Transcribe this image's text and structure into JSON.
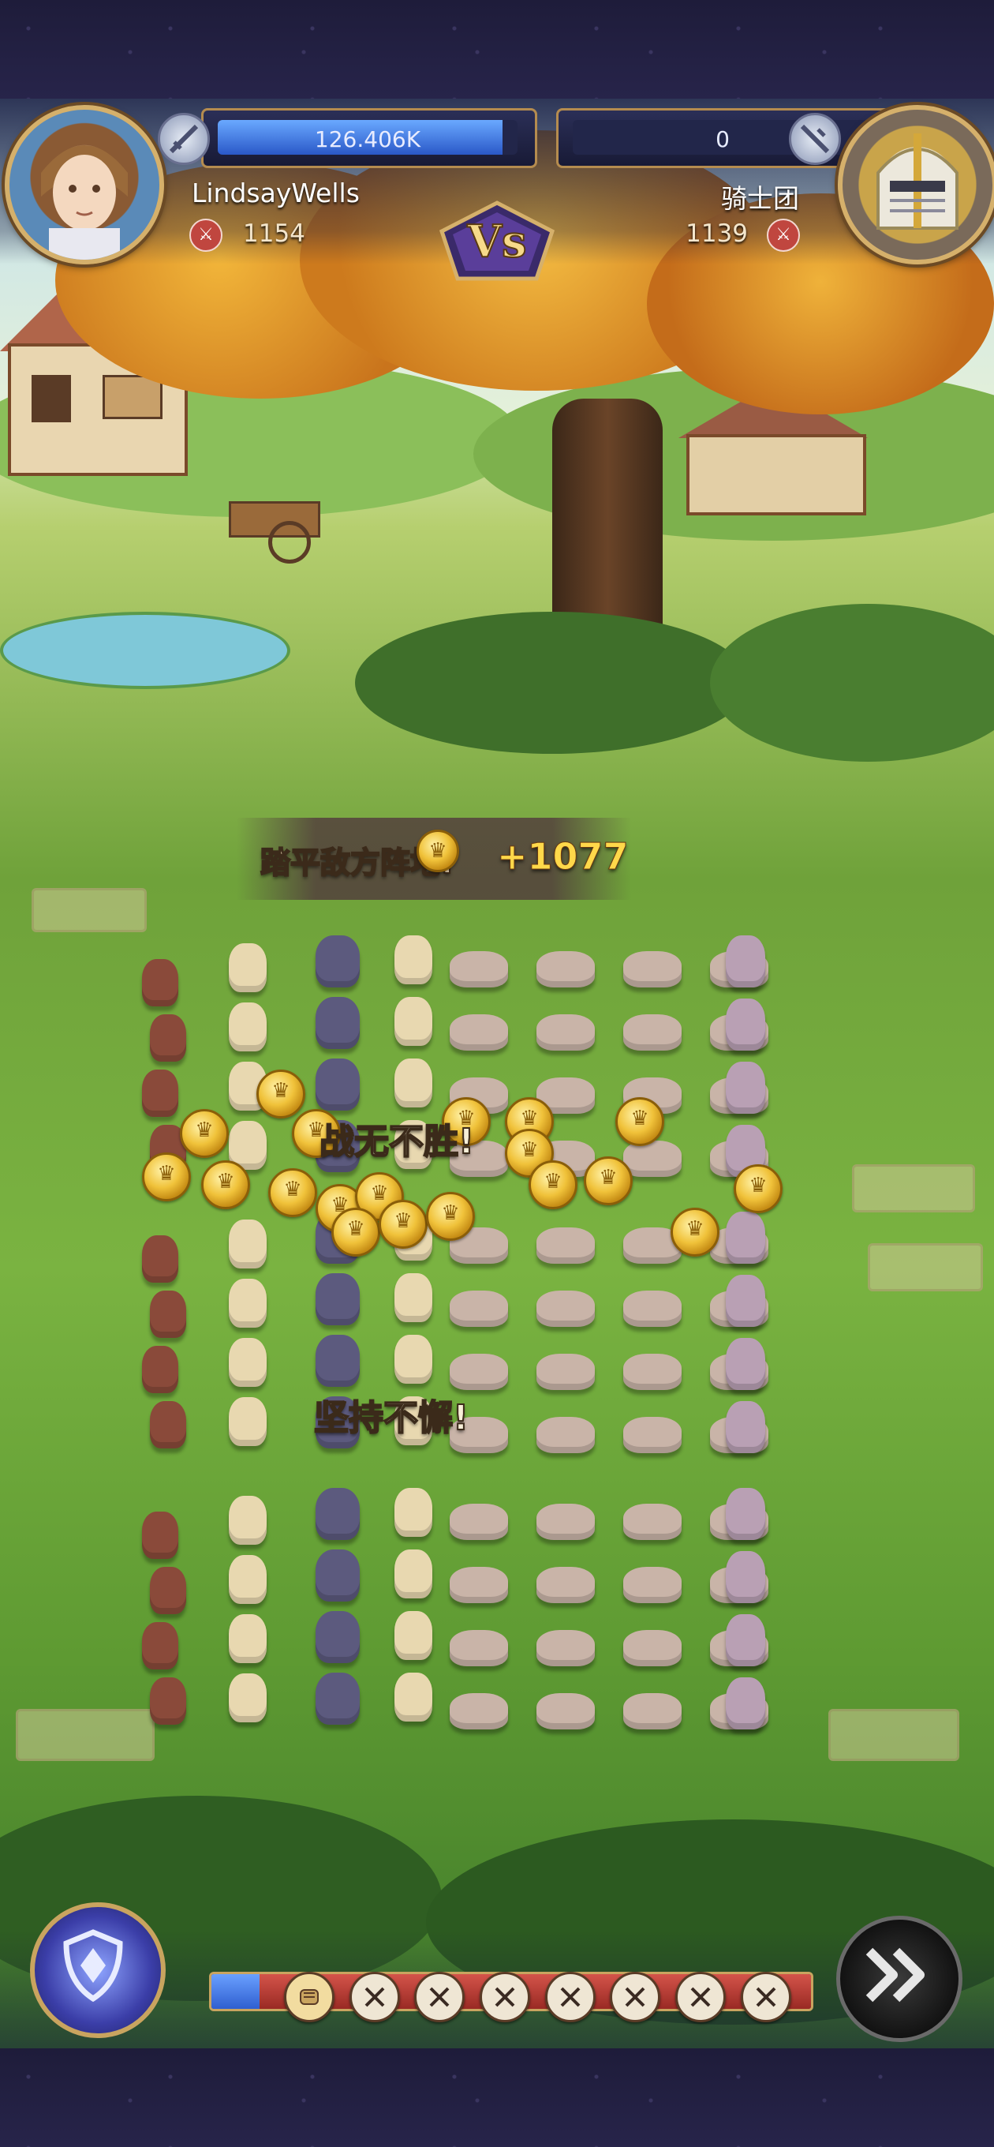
{
  "player": {
    "name": "LindsayWells",
    "hp_text": "126.406K",
    "hp_fraction": 0.95,
    "power": "1154",
    "avatar_icon": "hero-portrait"
  },
  "enemy": {
    "name": "骑士团",
    "hp_text": "0",
    "hp_fraction": 0,
    "power": "1139",
    "avatar_icon": "knight-portrait"
  },
  "vs_label": "Vs",
  "reward": {
    "label": "踏平敌方阵地!",
    "amount": "+1077",
    "icon": "gold-coin-icon"
  },
  "shouts": {
    "shout_1": "战无不胜!",
    "shout_2": "坚持不懈!"
  },
  "bottom": {
    "skill_icon": "shield-skill-icon",
    "speed_icon": "fast-forward-icon",
    "progress_fraction": 0.08,
    "waves": [
      {
        "icon": "fist-icon",
        "state": "current"
      },
      {
        "icon": "crossed-swords-icon",
        "state": "pending"
      },
      {
        "icon": "crossed-swords-icon",
        "state": "pending"
      },
      {
        "icon": "crossed-swords-icon",
        "state": "pending"
      },
      {
        "icon": "crossed-swords-icon",
        "state": "pending"
      },
      {
        "icon": "crossed-swords-icon",
        "state": "pending"
      },
      {
        "icon": "crossed-swords-icon",
        "state": "pending"
      },
      {
        "icon": "crossed-swords-icon",
        "state": "pending"
      }
    ]
  },
  "colors": {
    "player_bar": "#2a58c8",
    "enemy_bar": "#b03030",
    "gold": "#f0c23a"
  }
}
